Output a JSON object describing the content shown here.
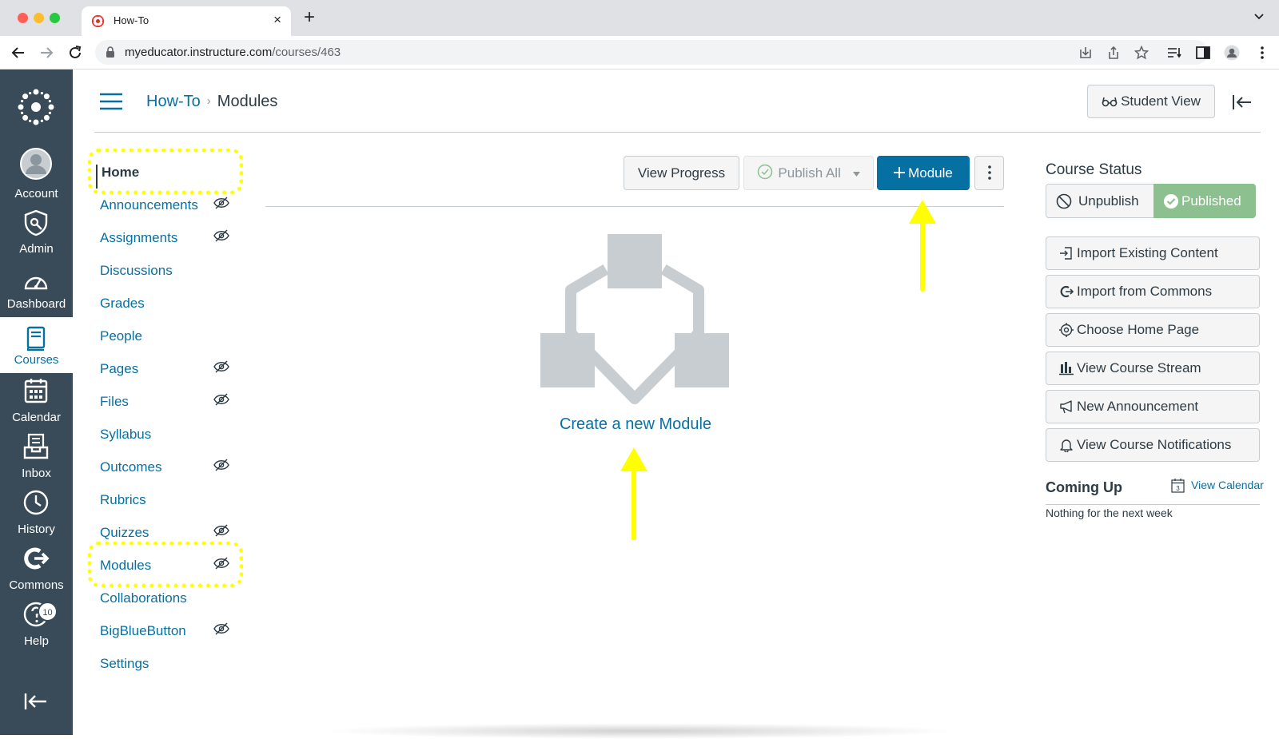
{
  "browser": {
    "tab_title": "How-To",
    "url_host": "myeducator.instructure.com",
    "url_path": "/courses/463",
    "colors": {
      "close": "#ff5f57",
      "minimize": "#febc2e",
      "maximize": "#28c840"
    }
  },
  "global_nav": {
    "items": [
      {
        "label": "Account",
        "icon": "account-icon"
      },
      {
        "label": "Admin",
        "icon": "admin-icon"
      },
      {
        "label": "Dashboard",
        "icon": "dashboard-icon"
      },
      {
        "label": "Courses",
        "icon": "courses-icon",
        "active": true
      },
      {
        "label": "Calendar",
        "icon": "calendar-icon"
      },
      {
        "label": "Inbox",
        "icon": "inbox-icon"
      },
      {
        "label": "History",
        "icon": "history-icon"
      },
      {
        "label": "Commons",
        "icon": "commons-icon"
      },
      {
        "label": "Help",
        "icon": "help-icon",
        "badge": "10"
      }
    ]
  },
  "header": {
    "breadcrumb_course": "How-To",
    "breadcrumb_separator": "›",
    "breadcrumb_page": "Modules",
    "student_view": "Student View"
  },
  "course_nav": {
    "items": [
      {
        "label": "Home",
        "active": true,
        "hidden": false
      },
      {
        "label": "Announcements",
        "hidden": true
      },
      {
        "label": "Assignments",
        "hidden": true
      },
      {
        "label": "Discussions",
        "hidden": false
      },
      {
        "label": "Grades",
        "hidden": false
      },
      {
        "label": "People",
        "hidden": false
      },
      {
        "label": "Pages",
        "hidden": true
      },
      {
        "label": "Files",
        "hidden": true
      },
      {
        "label": "Syllabus",
        "hidden": false
      },
      {
        "label": "Outcomes",
        "hidden": true
      },
      {
        "label": "Rubrics",
        "hidden": false
      },
      {
        "label": "Quizzes",
        "hidden": true
      },
      {
        "label": "Modules",
        "hidden": true
      },
      {
        "label": "Collaborations",
        "hidden": false
      },
      {
        "label": "BigBlueButton",
        "hidden": true
      },
      {
        "label": "Settings",
        "hidden": false
      }
    ]
  },
  "modules": {
    "view_progress": "View Progress",
    "publish_all": "Publish All",
    "add_module": "Module",
    "create_link": "Create a new Module"
  },
  "sidebar": {
    "course_status_title": "Course Status",
    "unpublish": "Unpublish",
    "published": "Published",
    "actions": [
      {
        "label": "Import Existing Content",
        "icon": "import-icon"
      },
      {
        "label": "Import from Commons",
        "icon": "commons-icon"
      },
      {
        "label": "Choose Home Page",
        "icon": "target-icon"
      },
      {
        "label": "View Course Stream",
        "icon": "bar-chart-icon"
      },
      {
        "label": "New Announcement",
        "icon": "megaphone-icon"
      },
      {
        "label": "View Course Notifications",
        "icon": "bell-icon"
      }
    ],
    "coming_up": "Coming Up",
    "view_calendar": "View Calendar",
    "calendar_day": "3",
    "nothing": "Nothing for the next week"
  },
  "colors": {
    "canvas_nav": "#394b58",
    "link": "#0770a3",
    "primary_button": "#0770a3",
    "published": "#8cc08e",
    "annotation": "#ffff00"
  }
}
